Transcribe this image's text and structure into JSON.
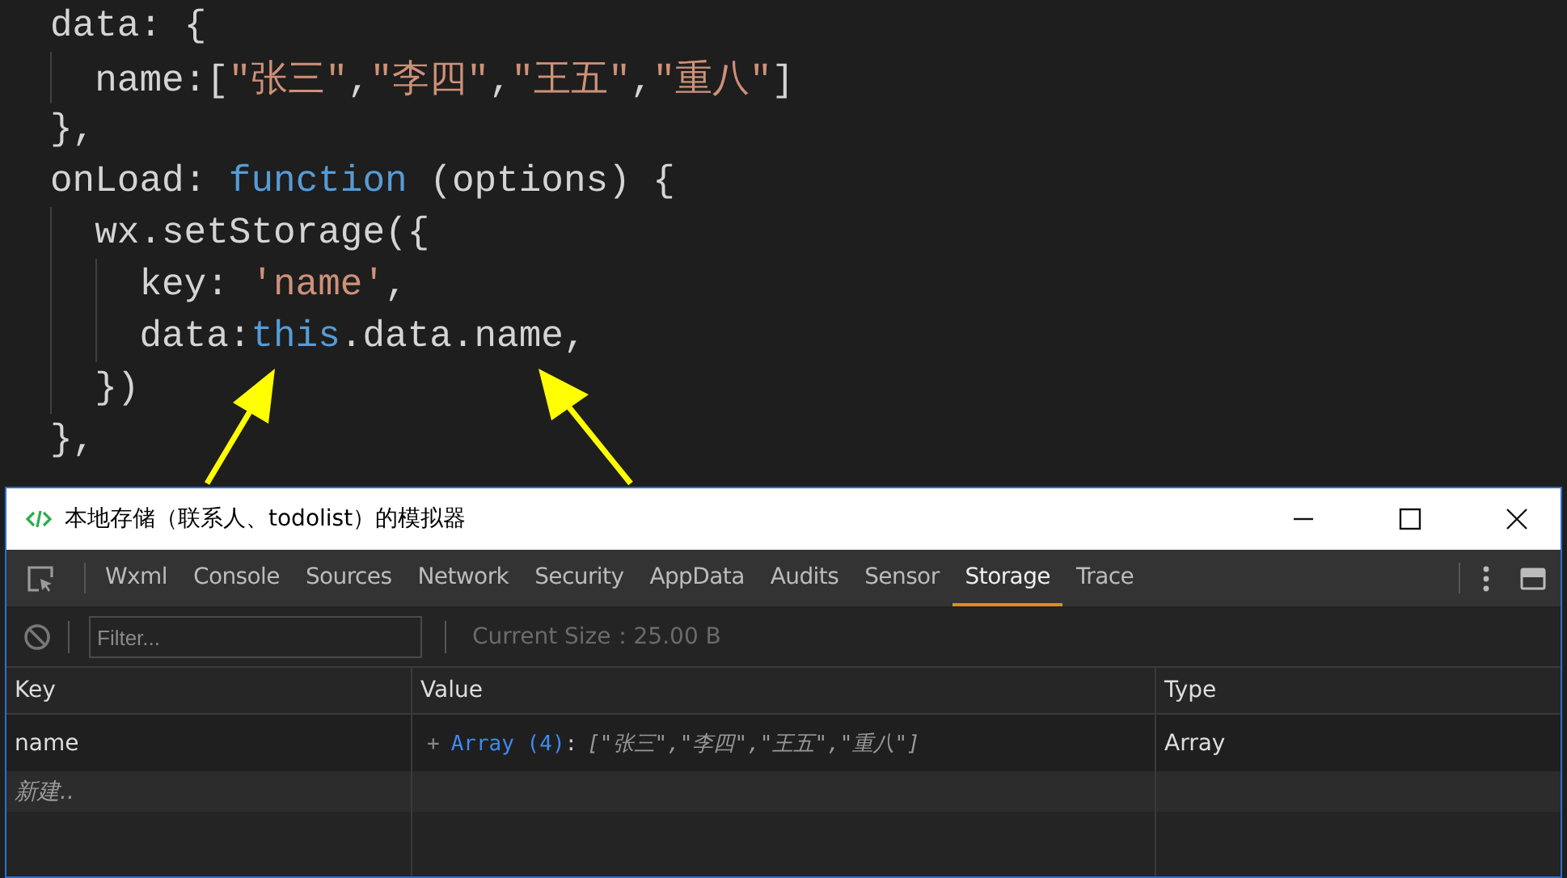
{
  "code": [
    {
      "tokens": [
        {
          "kind": "plain",
          "text": "data: {"
        }
      ],
      "children": [
        {
          "tokens": [
            {
              "kind": "plain",
              "text": "name:["
            },
            {
              "kind": "string",
              "text": "\"张三\""
            },
            {
              "kind": "plain",
              "text": ","
            },
            {
              "kind": "string",
              "text": "\"李四\""
            },
            {
              "kind": "plain",
              "text": ","
            },
            {
              "kind": "string",
              "text": "\"王五\""
            },
            {
              "kind": "plain",
              "text": ","
            },
            {
              "kind": "string",
              "text": "\"重八\""
            },
            {
              "kind": "plain",
              "text": "]"
            }
          ]
        }
      ]
    },
    {
      "tokens": [
        {
          "kind": "plain",
          "text": "},"
        }
      ]
    },
    {
      "tokens": [
        {
          "kind": "plain",
          "text": "onLoad: "
        },
        {
          "kind": "keyword",
          "text": "function"
        },
        {
          "kind": "plain",
          "text": " (options) {"
        }
      ],
      "children": [
        {
          "tokens": [
            {
              "kind": "plain",
              "text": "wx.setStorage({"
            }
          ],
          "children": [
            {
              "tokens": [
                {
                  "kind": "plain",
                  "text": "key: "
                },
                {
                  "kind": "string",
                  "text": "'name'"
                },
                {
                  "kind": "plain",
                  "text": ","
                }
              ]
            },
            {
              "tokens": [
                {
                  "kind": "plain",
                  "text": "data:"
                },
                {
                  "kind": "keyword",
                  "text": "this"
                },
                {
                  "kind": "plain",
                  "text": ".data.name,"
                }
              ]
            }
          ]
        },
        {
          "tokens": [
            {
              "kind": "plain",
              "text": "})"
            }
          ]
        }
      ]
    },
    {
      "tokens": [
        {
          "kind": "plain",
          "text": "},"
        }
      ]
    }
  ],
  "window": {
    "title": "本地存储（联系人、todolist）的模拟器",
    "tabs": [
      {
        "label": "Wxml",
        "selected": false
      },
      {
        "label": "Console",
        "selected": false
      },
      {
        "label": "Sources",
        "selected": false
      },
      {
        "label": "Network",
        "selected": false
      },
      {
        "label": "Security",
        "selected": false
      },
      {
        "label": "AppData",
        "selected": false
      },
      {
        "label": "Audits",
        "selected": false
      },
      {
        "label": "Sensor",
        "selected": false
      },
      {
        "label": "Storage",
        "selected": true
      },
      {
        "label": "Trace",
        "selected": false
      }
    ],
    "filter": {
      "placeholder": "Filter..."
    },
    "current_size": "Current Size：25.00 B",
    "table": {
      "columns": [
        "Key",
        "Value",
        "Type"
      ],
      "rows": [
        {
          "kind": "entry",
          "key": "name",
          "value": [
            {
              "kind": "expander",
              "text": "+"
            },
            {
              "kind": "type",
              "text": "Array (4)"
            },
            {
              "kind": "punct",
              "text": ":"
            },
            {
              "kind": "items",
              "text": "[\"张三\",\"李四\",\"王五\",\"重八\"]"
            }
          ],
          "type": "Array"
        },
        {
          "kind": "new",
          "key": "新建.."
        }
      ]
    }
  }
}
